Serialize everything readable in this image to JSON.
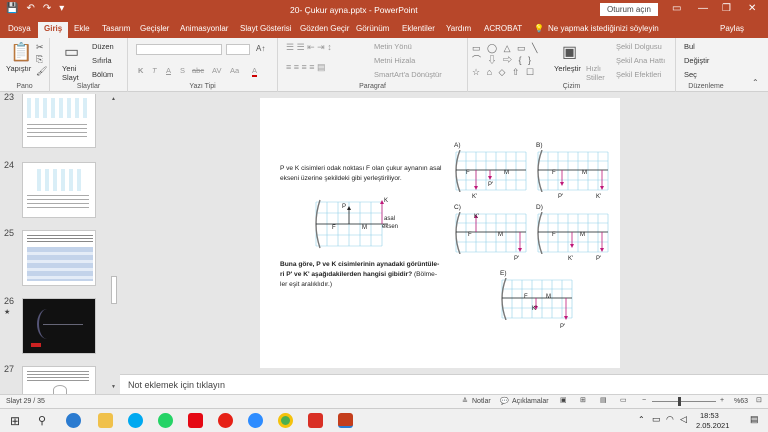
{
  "window": {
    "title": "20- Çukur ayna.pptx  -  PowerPoint",
    "signin": "Oturum açın",
    "minimize": "—",
    "restore": "❐",
    "close": "✕"
  },
  "quick": {
    "save": "💾",
    "undo": "↶",
    "redo": "↷",
    "customize": "▾"
  },
  "tabs": [
    "Dosya",
    "Giriş",
    "Ekle",
    "Tasarım",
    "Geçişler",
    "Animasyonlar",
    "Slayt Gösterisi",
    "Gözden Geçir",
    "Görünüm",
    "Eklentiler",
    "Yardım",
    "ACROBAT"
  ],
  "tellme": "Ne yapmak istediğinizi söyleyin",
  "share": "Paylaş",
  "ribbon": {
    "pano": {
      "label": "Pano",
      "paste": "Yapıştır"
    },
    "slaytlar": {
      "label": "Slaytlar",
      "new": "Yeni Slayt",
      "layout": "Düzen",
      "reset": "Sıfırla",
      "section": "Bölüm"
    },
    "font": {
      "label": "Yazı Tipi",
      "bold": "K",
      "italic": "T",
      "underline": "A",
      "strike": "S",
      "shadow": "abc",
      "spacing": "AV",
      "case": "Aa",
      "color": "A"
    },
    "paragraph": {
      "label": "Paragraf",
      "direction": "Metin Yönü",
      "align": "Metni Hizala",
      "smartart": "SmartArt'a Dönüştür"
    },
    "drawing": {
      "label": "Çizim",
      "arrange": "Yerleştir",
      "quick": "Hızlı Stiller",
      "fill": "Şekil Dolgusu",
      "outline": "Şekil Ana Hattı",
      "effects": "Şekil Efektleri"
    },
    "editing": {
      "label": "Düzenleme",
      "find": "Bul",
      "replace": "Değiştir",
      "select": "Seç"
    }
  },
  "thumbs": [
    {
      "n": "23"
    },
    {
      "n": "24"
    },
    {
      "n": "25"
    },
    {
      "n": "26"
    },
    {
      "n": "27"
    }
  ],
  "slide": {
    "intro": [
      "P ve K cisimleri odak noktası F olan çukur aynanın asal",
      "ekseni üzerine şekildeki gibi yerleştiriliyor."
    ],
    "question_bold": [
      "Buna göre, P ve K cisimlerinin aynadaki görüntüle-",
      "ri P' ve K'  aşağıdakilerden hangisi gibidir?"
    ],
    "question_tail": " (Bölme-",
    "question_last": "ler eşit aralıklıdır.)",
    "main_fig": {
      "p": "P",
      "k": "K",
      "f": "F",
      "m": "M",
      "axis1": "asal",
      "axis2": "eksen"
    },
    "options": [
      {
        "label": "A)",
        "f": "F",
        "m": "M",
        "p": "P'",
        "k": "K'"
      },
      {
        "label": "B)",
        "f": "F",
        "m": "M",
        "p": "P'",
        "k": "K'"
      },
      {
        "label": "C)",
        "f": "F",
        "m": "M",
        "p": "P'",
        "k": "K'"
      },
      {
        "label": "D)",
        "f": "F",
        "m": "M",
        "p": "P'",
        "k": "K'"
      },
      {
        "label": "E)",
        "f": "F",
        "m": "M",
        "p": "P'",
        "k": "K'"
      }
    ]
  },
  "notes": "Not eklemek için tıklayın",
  "status": {
    "slide": "Slayt 29 / 35",
    "notes": "Notlar",
    "comments": "Açıklamalar",
    "zoom": "%63"
  },
  "clock": {
    "time": "18:53",
    "date": "2.05.2021"
  },
  "colors": {
    "accent": "#b7472a",
    "grid": "#8fd0e8",
    "arrow": "#c0187a"
  }
}
